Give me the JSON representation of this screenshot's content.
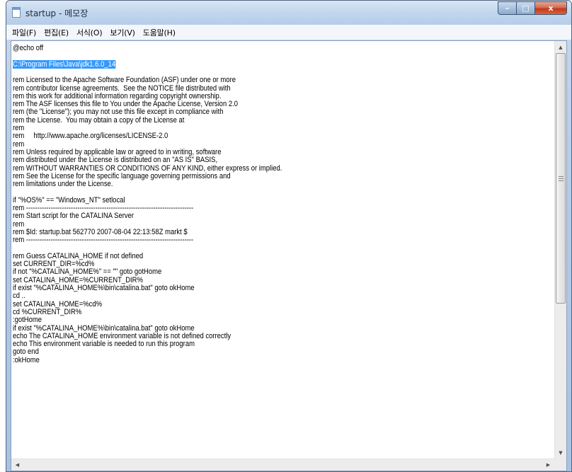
{
  "window": {
    "title": "startup - 메모장",
    "buttons": {
      "minimize": "–",
      "maximize": "□",
      "close": "x"
    }
  },
  "menu": [
    "파일(F)",
    "편집(E)",
    "서식(O)",
    "보기(V)",
    "도움말(H)"
  ],
  "content": {
    "lines": [
      "@echo off",
      "",
      "C:\\Program Files\\Java\\jdk1.6.0_14",
      "",
      "rem Licensed to the Apache Software Foundation (ASF) under one or more",
      "rem contributor license agreements.  See the NOTICE file distributed with",
      "rem this work for additional information regarding copyright ownership.",
      "rem The ASF licenses this file to You under the Apache License, Version 2.0",
      "rem (the \"License\"); you may not use this file except in compliance with",
      "rem the License.  You may obtain a copy of the License at",
      "rem",
      "rem     http://www.apache.org/licenses/LICENSE-2.0",
      "rem",
      "rem Unless required by applicable law or agreed to in writing, software",
      "rem distributed under the License is distributed on an \"AS IS\" BASIS,",
      "rem WITHOUT WARRANTIES OR CONDITIONS OF ANY KIND, either express or implied.",
      "rem See the License for the specific language governing permissions and",
      "rem limitations under the License.",
      "",
      "if \"%OS%\" == \"Windows_NT\" setlocal",
      "rem ---------------------------------------------------------------------------",
      "rem Start script for the CATALINA Server",
      "rem",
      "rem $Id: startup.bat 562770 2007-08-04 22:13:58Z markt $",
      "rem ---------------------------------------------------------------------------",
      "",
      "rem Guess CATALINA_HOME if not defined",
      "set CURRENT_DIR=%cd%",
      "if not \"%CATALINA_HOME%\" == \"\" goto gotHome",
      "set CATALINA_HOME=%CURRENT_DIR%",
      "if exist \"%CATALINA_HOME%\\bin\\catalina.bat\" goto okHome",
      "cd ..",
      "set CATALINA_HOME=%cd%",
      "cd %CURRENT_DIR%",
      ":gotHome",
      "if exist \"%CATALINA_HOME%\\bin\\catalina.bat\" goto okHome",
      "echo The CATALINA_HOME environment variable is not defined correctly",
      "echo This environment variable is needed to run this program",
      "goto end",
      ":okHome"
    ],
    "selected_line": 2
  },
  "colors": {
    "selection": "#3399ff",
    "close_button": "#c1391c",
    "frame": "#b4cbe6"
  }
}
